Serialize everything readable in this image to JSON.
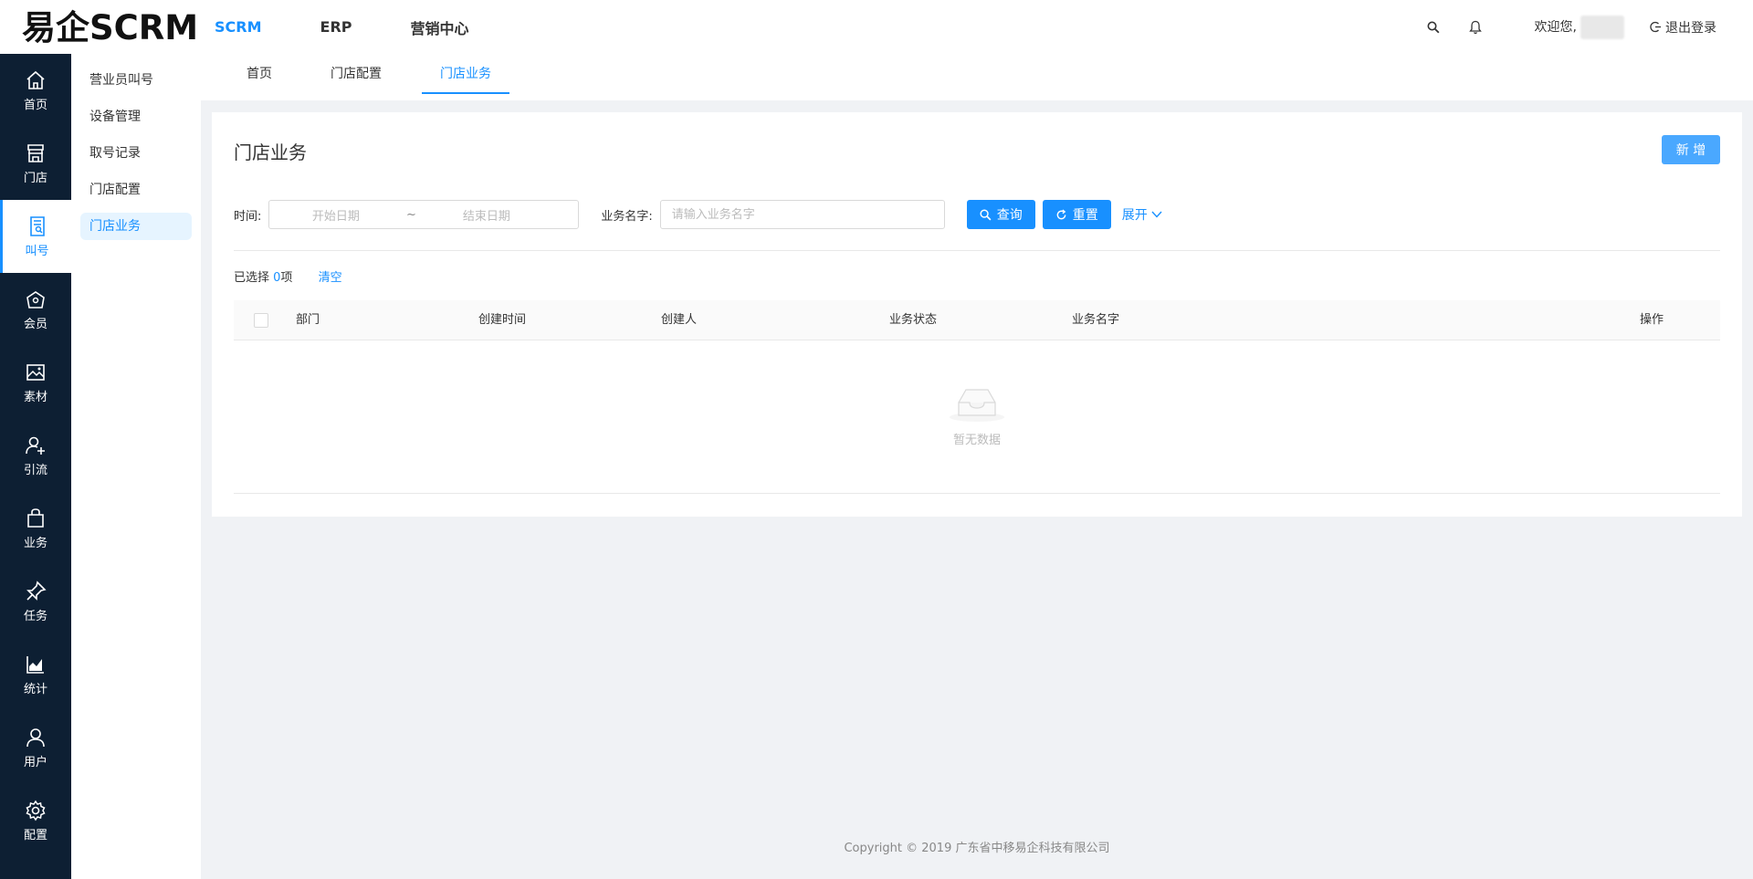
{
  "header": {
    "logo": "易企SCRM",
    "nav": [
      "SCRM",
      "ERP",
      "营销中心"
    ],
    "welcome": "欢迎您,",
    "logout": "退出登录"
  },
  "sidebar": {
    "items": [
      {
        "label": "首页",
        "icon": "home-icon"
      },
      {
        "label": "门店",
        "icon": "store-icon"
      },
      {
        "label": "叫号",
        "icon": "ticket-icon"
      },
      {
        "label": "会员",
        "icon": "member-icon"
      },
      {
        "label": "素材",
        "icon": "image-icon"
      },
      {
        "label": "引流",
        "icon": "user-add-icon"
      },
      {
        "label": "业务",
        "icon": "bag-icon"
      },
      {
        "label": "任务",
        "icon": "pin-icon"
      },
      {
        "label": "统计",
        "icon": "chart-icon"
      },
      {
        "label": "用户",
        "icon": "user-icon"
      },
      {
        "label": "配置",
        "icon": "gear-icon"
      }
    ],
    "active": "叫号"
  },
  "subsidebar": {
    "items": [
      "营业员叫号",
      "设备管理",
      "取号记录",
      "门店配置",
      "门店业务"
    ],
    "active": "门店业务"
  },
  "tabs": {
    "items": [
      "首页",
      "门店配置",
      "门店业务"
    ],
    "active": "门店业务"
  },
  "main": {
    "title": "门店业务",
    "add_label": "新 增",
    "filter": {
      "time_label": "时间:",
      "start_placeholder": "开始日期",
      "range_sep": "~",
      "end_placeholder": "结束日期",
      "name_label": "业务名字:",
      "name_placeholder": "请输入业务名字",
      "search_label": "查询",
      "reset_label": "重置",
      "expand_label": "展开"
    },
    "selected": {
      "prefix": "已选择 ",
      "count": "0",
      "suffix": "项",
      "clear": "清空"
    },
    "table": {
      "columns": [
        "部门",
        "创建时间",
        "创建人",
        "业务状态",
        "业务名字",
        "操作"
      ],
      "empty_text": "暂无数据"
    }
  },
  "footer": "Copyright © 2019 广东省中移易企科技有限公司",
  "colors": {
    "accent": "#1890ff",
    "sidebar_bg": "#0d1f33",
    "add_button": "#4aa8ff"
  }
}
